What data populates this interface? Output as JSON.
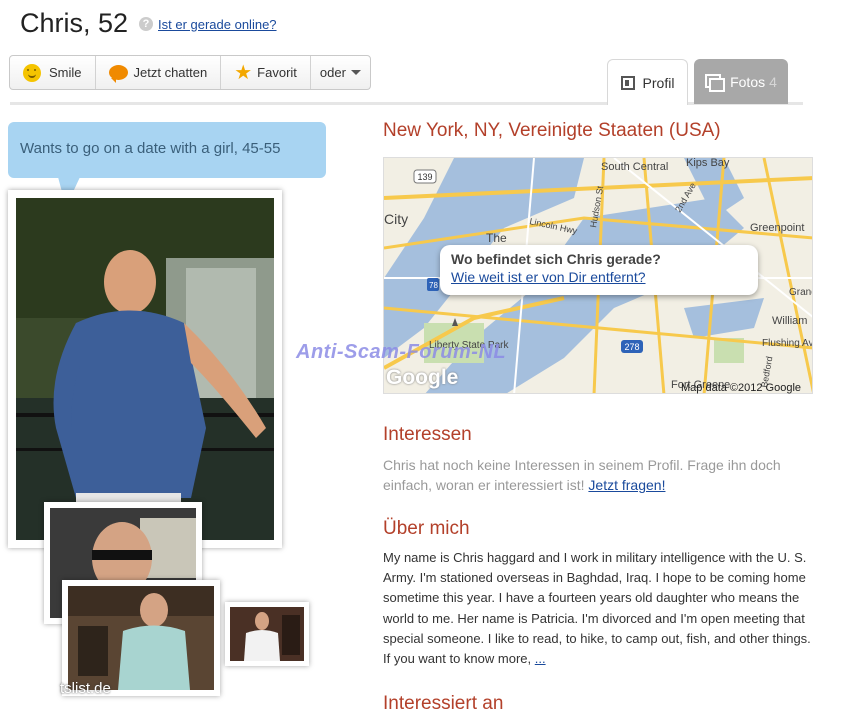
{
  "profile": {
    "title": "Chris, 52",
    "online_link": "Ist er gerade online?"
  },
  "actions": {
    "smile": "Smile",
    "chat": "Jetzt chatten",
    "favorite": "Favorit",
    "more": "oder"
  },
  "tabs": {
    "profil": "Profil",
    "fotos": "Fotos",
    "fotos_count": "4"
  },
  "bubble": "Wants to go on a date with a girl, 45-55",
  "photo_caption": "tslist.de",
  "location": "New York, NY, Vereinigte Staaten (USA)",
  "map": {
    "question": "Wo befindet sich Chris gerade?",
    "distance_link": "Wie weit ist er von Dir entfernt?",
    "credit": "Map data ©2012 Google",
    "logo": "Google",
    "labels": [
      "City",
      "South Central",
      "Kips Bay",
      "Greenpoint",
      "Lincoln Hwy",
      "Hudson St",
      "2nd Ave",
      "The",
      "Liberty State Park",
      "Fort Greene",
      "William",
      "Flushing Ave",
      "Grand",
      "Bedford",
      "139",
      "278",
      "78"
    ]
  },
  "interessen": {
    "heading": "Interessen",
    "text": "Chris hat noch keine Interessen in seinem Profil. Frage ihn doch einfach, woran er interessiert ist!",
    "link": "Jetzt fragen!"
  },
  "ueber_mich": {
    "heading": "Über mich",
    "text": "My name is Chris haggard and I work in military intelligence with the U. S. Army. I'm stationed overseas in Baghdad, Iraq. I hope to be coming home sometime this year. I have a fourteen years old daughter who means the world to me. Her name is Patricia. I'm divorced and I'm open meeting that special someone. I like to read, to hike, to camp out, fish, and other things. If you want to know more,",
    "more_link": "..."
  },
  "next_heading": "Interessiert an",
  "watermark": "Anti-Scam-Forum-NL",
  "colors": {
    "heading": "#b3402a",
    "link": "#1a4a9c",
    "bubble": "#a8d4f2",
    "tab_inactive": "#a8a8a8"
  }
}
